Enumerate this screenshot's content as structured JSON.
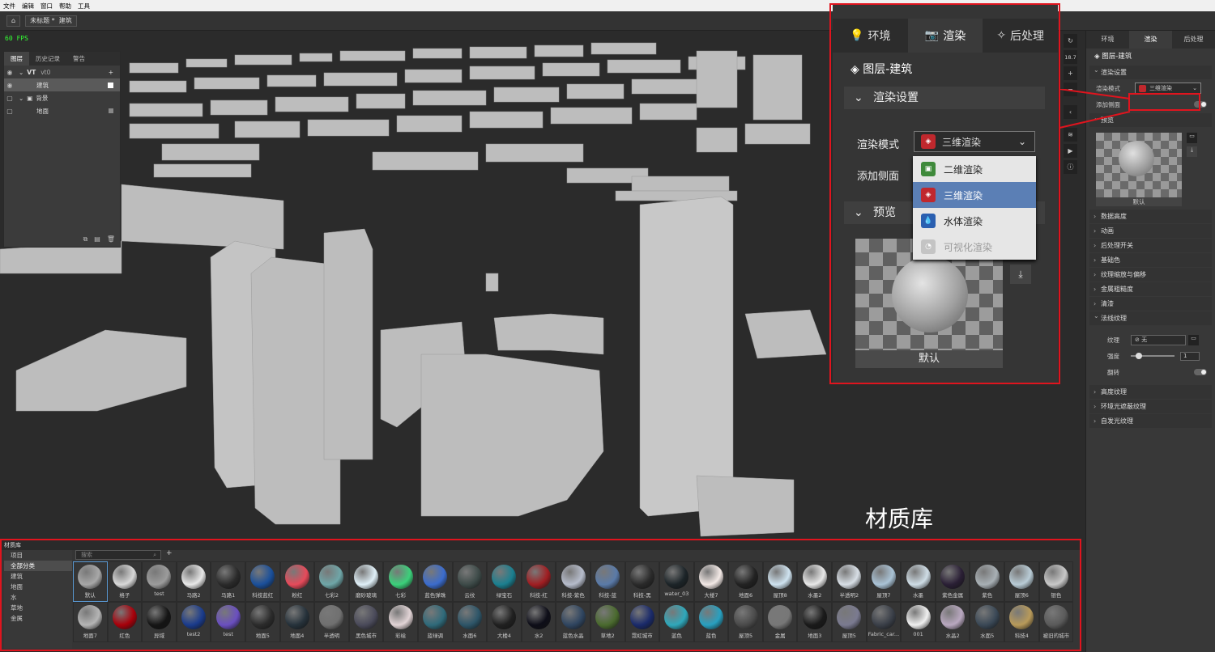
{
  "menubar": {
    "items": [
      "文件",
      "编辑",
      "窗口",
      "帮助",
      "工具"
    ]
  },
  "toolbar": {
    "home_icon": "home-icon",
    "doc_title": "未标题 *",
    "layer_label": "建筑"
  },
  "viewport": {
    "fps": "60 FPS"
  },
  "layers_panel": {
    "tabs": [
      "图层",
      "历史记录",
      "警告"
    ],
    "rows": [
      {
        "label": "VT",
        "sub": "vt0"
      },
      {
        "label": "建筑"
      },
      {
        "label": "背景"
      },
      {
        "label": "地面"
      }
    ]
  },
  "view_tools": {
    "zoom_value": "18.7",
    "plus": "+",
    "minus": "−"
  },
  "right_panel": {
    "tabs": [
      "环境",
      "渲染",
      "后处理"
    ],
    "title": "图层-建筑",
    "render_settings": "渲染设置",
    "render_mode_label": "渲染模式",
    "render_mode_value": "三维渲染",
    "add_side_label": "添加侧面",
    "preview_label": "预览",
    "preview_caption": "默认",
    "sections": [
      "数据高度",
      "动画",
      "后处理开关",
      "基础色",
      "纹理缩放与偏移",
      "金属粗糙度",
      "清漆"
    ],
    "normal_texture": "法线纹理",
    "texture_label": "纹理",
    "texture_value": "无",
    "strength_label": "强度",
    "strength_value": "1",
    "flip_label": "翻转",
    "sections2": [
      "高度纹理",
      "环境光遮蔽纹理",
      "自发光纹理"
    ]
  },
  "zoom": {
    "tabs": [
      "环境",
      "渲染",
      "后处理"
    ],
    "title": "图层-建筑",
    "render_settings": "渲染设置",
    "render_mode_label": "渲染模式",
    "render_mode_value": "三维渲染",
    "add_side_label": "添加侧面",
    "preview_label": "预览",
    "preview_caption": "默认",
    "menu": [
      "二维渲染",
      "三维渲染",
      "水体渲染",
      "可视化渲染"
    ]
  },
  "library": {
    "caption": "材质库",
    "header": "材质库",
    "search_placeholder": "搜索",
    "categories": [
      "项目",
      "全部分类",
      "建筑",
      "地面",
      "水",
      "草地",
      "金属"
    ],
    "row1": [
      "默认",
      "格子",
      "test",
      "马路2",
      "马路1",
      "科技蓝红",
      "粉红",
      "七彩2",
      "磨砂玻璃",
      "七彩",
      "蓝色弹珠",
      "云纹",
      "绿宝石",
      "科技-红",
      "科技-紫色",
      "科技-蓝",
      "科技-黑",
      "water_03",
      "大楼7",
      "地面6",
      "屋顶8",
      "水墨2",
      "半透明2",
      "屋顶7",
      "水墨",
      "紫色金属",
      "紫色",
      "屋顶6",
      "银色"
    ],
    "row2": [
      "地面7",
      "红色",
      "异域",
      "test2",
      "test",
      "地面5",
      "地面4",
      "半透明",
      "黑色城市",
      "彩绘",
      "蓝绿调",
      "水面6",
      "大楼4",
      "水2",
      "蓝色水晶",
      "草地2",
      "霓虹城市",
      "蓝色",
      "蓝色",
      "屋顶5",
      "金属",
      "地面3",
      "屋顶5",
      "Fabric_car...",
      "001",
      "水晶2",
      "水面5",
      "科技4",
      "被旧的城市"
    ]
  },
  "colors": {
    "accent_red": "#e0141e",
    "highlight": "#5b7fb5",
    "fps": "#33ff33"
  }
}
